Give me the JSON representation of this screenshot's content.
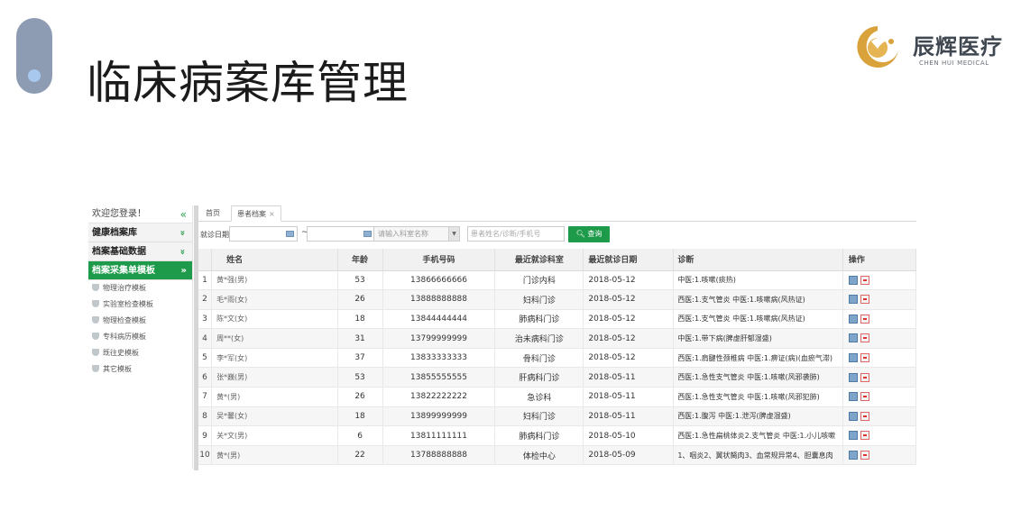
{
  "slide": {
    "title": "临床病案库管理",
    "logo_cn": "辰辉医疗",
    "logo_en": "CHEN HUI MEDICAL"
  },
  "sidebar": {
    "welcome": "欢迎您登录！",
    "collapse_glyph": "«",
    "sections": [
      {
        "label": "健康档案库",
        "arrow": "»"
      },
      {
        "label": "档案基础数据",
        "arrow": "»"
      },
      {
        "label": "档案采集单模板",
        "arrow": "»"
      }
    ],
    "items": [
      "物理治疗模板",
      "实验室检查模板",
      "物理检查模板",
      "专科病历模板",
      "既往史模板",
      "其它模板"
    ]
  },
  "tabs": {
    "home": "首页",
    "active": "患者档案",
    "close": "×"
  },
  "filter": {
    "date_label": "就诊日期：",
    "tilde": "~",
    "dept_placeholder": "请输入科室名称",
    "search_placeholder": "患者姓名/诊断/手机号",
    "query_label": "查询"
  },
  "table": {
    "headers": [
      "",
      "姓名",
      "年龄",
      "手机号码",
      "最近就诊科室",
      "最近就诊日期",
      "诊断",
      "操作"
    ],
    "rows": [
      {
        "idx": "1",
        "name": "黄*强(男)",
        "age": "53",
        "phone": "13866666666",
        "dept": "门诊内科",
        "date": "2018-05-12",
        "diag": "中医:1.咳嗽(痰热)"
      },
      {
        "idx": "2",
        "name": "毛*雨(女)",
        "age": "26",
        "phone": "13888888888",
        "dept": "妇科门诊",
        "date": "2018-05-12",
        "diag": "西医:1.支气管炎 中医:1.咳嗽病(风热证)"
      },
      {
        "idx": "3",
        "name": "陈*文(女)",
        "age": "18",
        "phone": "13844444444",
        "dept": "肺病科门诊",
        "date": "2018-05-12",
        "diag": "西医:1.支气管炎 中医:1.咳嗽病(风热证)"
      },
      {
        "idx": "4",
        "name": "周**(女)",
        "age": "31",
        "phone": "13799999999",
        "dept": "治未病科门诊",
        "date": "2018-05-12",
        "diag": "中医:1.带下病(脾虚肝郁湿盛)"
      },
      {
        "idx": "5",
        "name": "李*军(女)",
        "age": "37",
        "phone": "13833333333",
        "dept": "骨科门诊",
        "date": "2018-05-12",
        "diag": "西医:1.肩腱性颈椎病 中医:1.痹证(病)(血瘀气滞)"
      },
      {
        "idx": "6",
        "name": "张*巍(男)",
        "age": "53",
        "phone": "13855555555",
        "dept": "肝病科门诊",
        "date": "2018-05-11",
        "diag": "西医:1.急性支气管炎 中医:1.咳嗽(风邪袭肺)"
      },
      {
        "idx": "7",
        "name": "黄*(男)",
        "age": "26",
        "phone": "13822222222",
        "dept": "急诊科",
        "date": "2018-05-11",
        "diag": "西医:1.急性支气管炎 中医:1.咳嗽(风邪犯肺)"
      },
      {
        "idx": "8",
        "name": "吴*馨(女)",
        "age": "18",
        "phone": "13899999999",
        "dept": "妇科门诊",
        "date": "2018-05-11",
        "diag": "西医:1.腹泻 中医:1.泄泻(脾虚湿盛)"
      },
      {
        "idx": "9",
        "name": "关*文(男)",
        "age": "6",
        "phone": "13811111111",
        "dept": "肺病科门诊",
        "date": "2018-05-10",
        "diag": "西医:1.急性扁桃体炎2.支气管炎 中医:1.小儿咳嗽"
      },
      {
        "idx": "10",
        "name": "黄*(男)",
        "age": "22",
        "phone": "13788888888",
        "dept": "体检中心",
        "date": "2018-05-09",
        "diag": "1、咽炎2、翼状胬肉3、血常规异常4、胆囊息肉"
      }
    ]
  },
  "colors": {
    "accent_green": "#1e9b4a",
    "pill": "#8d9cb3",
    "logo_gold": "#d9a23a"
  }
}
